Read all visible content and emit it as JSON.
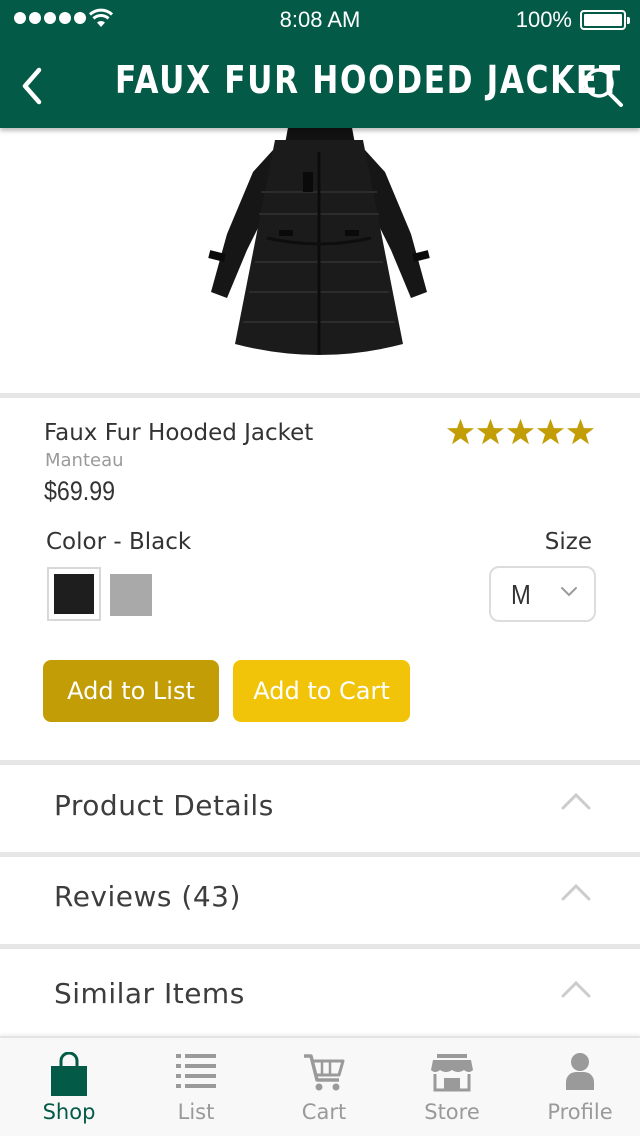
{
  "status_bar": {
    "time": "8:08 AM",
    "battery": "100%"
  },
  "header": {
    "title": "FAUX FUR HOODED JACKET"
  },
  "product": {
    "name": "Faux Fur Hooded Jacket",
    "brand": "Manteau",
    "price": "$69.99",
    "rating": 5,
    "color_label": "Color - Black",
    "colors": [
      "black",
      "gray"
    ],
    "size_label": "Size",
    "size_value": "M"
  },
  "actions": {
    "add_to_list": "Add to List",
    "add_to_cart": "Add to Cart"
  },
  "sections": [
    {
      "label": "Product Details"
    },
    {
      "label": "Reviews (43)"
    },
    {
      "label": "Similar Items"
    }
  ],
  "tabs": [
    {
      "label": "Shop",
      "icon": "bag-icon",
      "active": true
    },
    {
      "label": "List",
      "icon": "list-icon",
      "active": false
    },
    {
      "label": "Cart",
      "icon": "cart-icon",
      "active": false
    },
    {
      "label": "Store",
      "icon": "store-icon",
      "active": false
    },
    {
      "label": "Profile",
      "icon": "person-icon",
      "active": false
    }
  ],
  "colors": {
    "header": "#035a47",
    "gold": "#c29d06",
    "yellow": "#f1c409",
    "star": "#c29d06"
  }
}
